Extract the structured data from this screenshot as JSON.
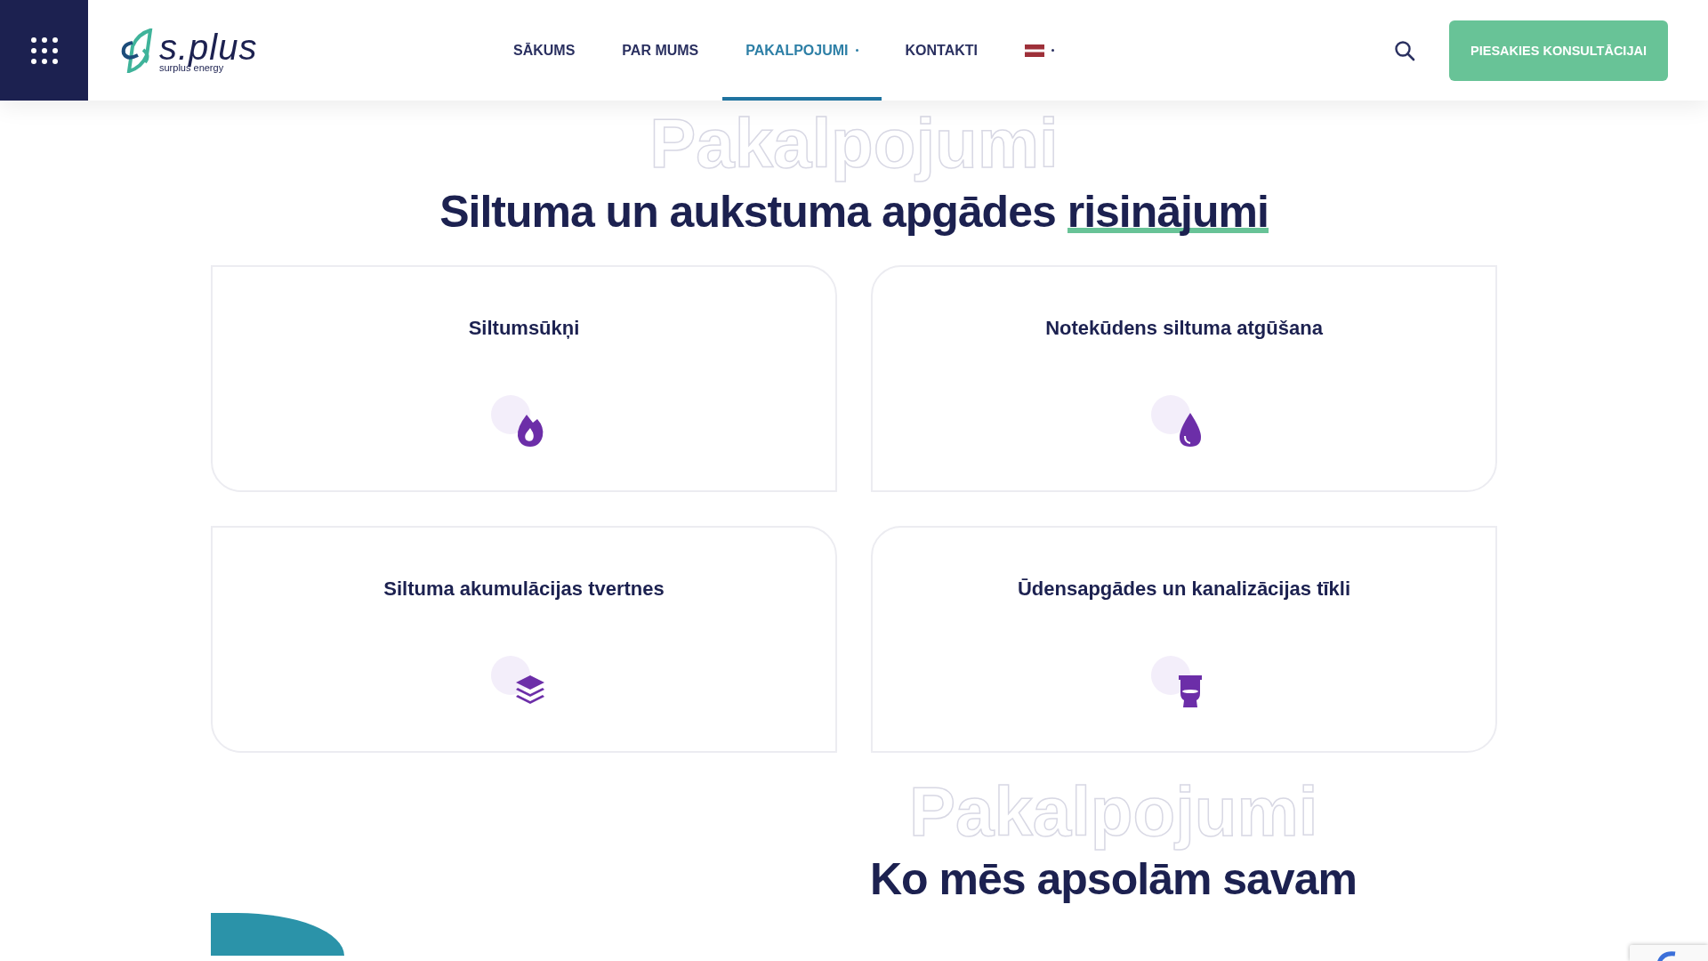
{
  "header": {
    "logo": {
      "wordmark": "s.plus",
      "tagline": "surplus energy"
    },
    "nav": [
      {
        "label": "SĀKUMS",
        "kind": "text",
        "selected": false,
        "dropdown": false
      },
      {
        "label": "PAR MUMS",
        "kind": "text",
        "selected": false,
        "dropdown": false
      },
      {
        "label": "PAKALPOJUMI",
        "kind": "text",
        "selected": true,
        "dropdown": true
      },
      {
        "label": "KONTAKTI",
        "kind": "text",
        "selected": false,
        "dropdown": false
      },
      {
        "kind": "flag",
        "selected": false,
        "dropdown": true
      }
    ],
    "cta_button": "PIESAKIES KONSULTĀCIJAI"
  },
  "services": {
    "background_word": "Pakalpojumi",
    "title": "Siltuma un aukstuma apgādes",
    "title_highlight": "risinājumi",
    "cards": [
      {
        "title": "Siltumsūkņi",
        "kind": "flame"
      },
      {
        "title": "Notekūdens siltuma atgūšana",
        "kind": "drop"
      },
      {
        "title": "Siltuma akumulācijas tvertnes",
        "kind": "layers"
      },
      {
        "title": "Ūdensapgādes un kanalizācijas tīkli",
        "kind": "toilet"
      }
    ]
  },
  "promise": {
    "background_word": "Pakalpojumi",
    "title": "Ko mēs apsolām savam"
  }
}
